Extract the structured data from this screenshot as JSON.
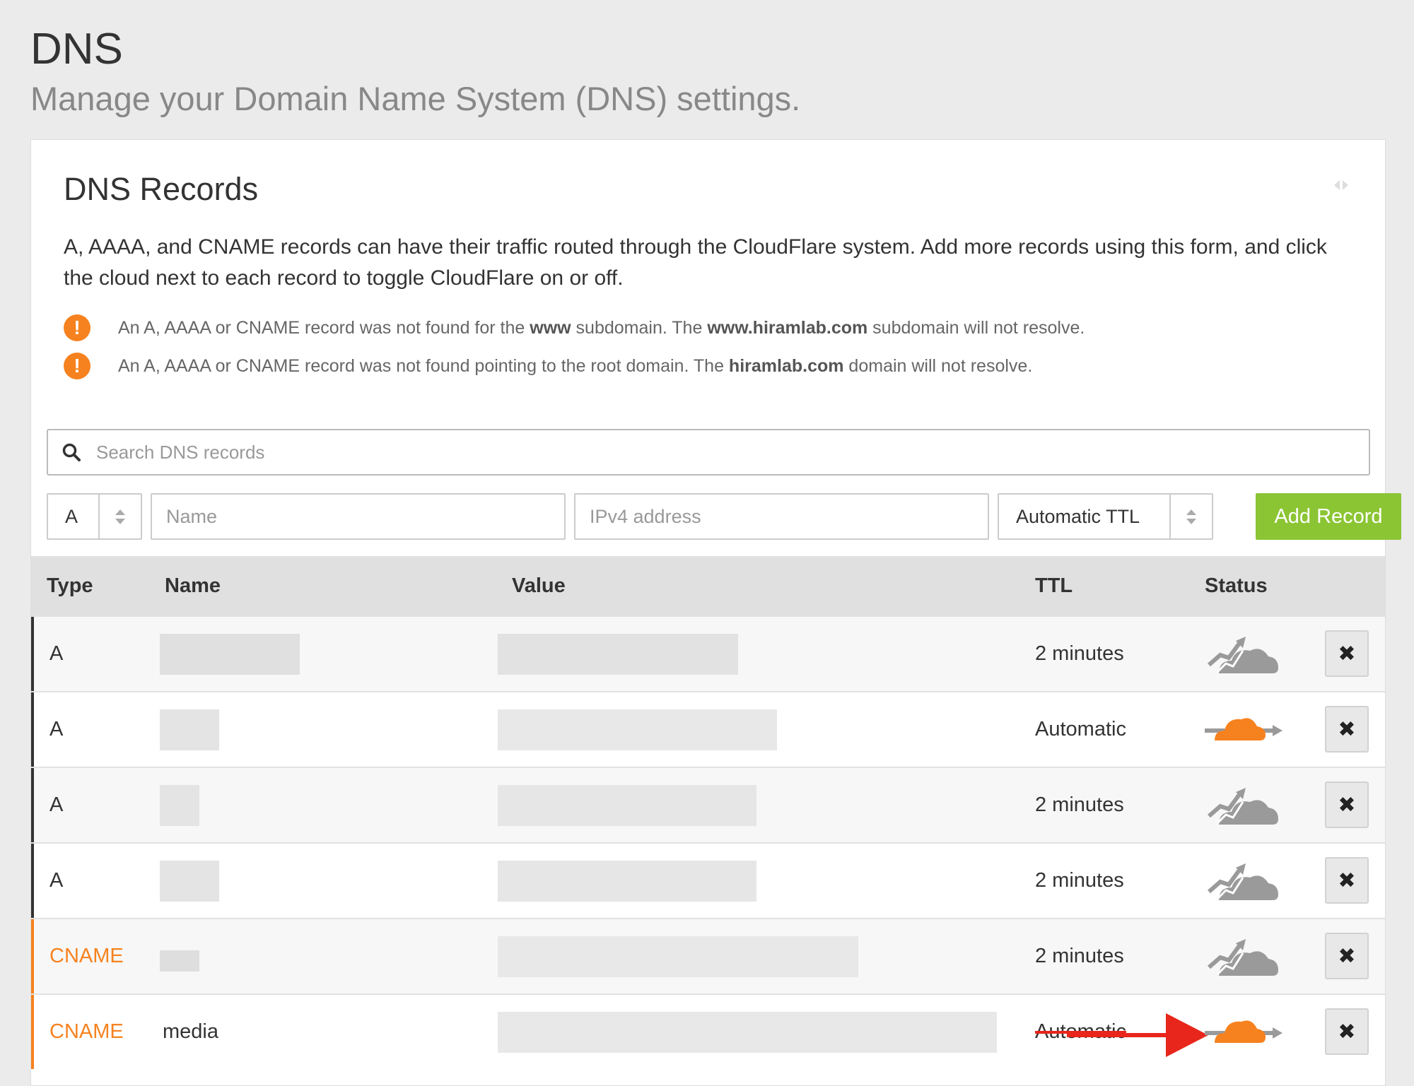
{
  "header": {
    "title": "DNS",
    "subtitle": "Manage your Domain Name System (DNS) settings."
  },
  "card": {
    "title": "DNS Records",
    "description": "A, AAAA, and CNAME records can have their traffic routed through the CloudFlare system. Add more records using this form, and click the cloud next to each record to toggle CloudFlare on or off.",
    "warnings": [
      {
        "icon": "exclamation-icon",
        "text_a": "An A, AAAA or CNAME record was not found for the ",
        "bold_a": "www",
        "text_b": " subdomain. The ",
        "bold_b": "www.hiramlab.com",
        "text_c": " subdomain will not resolve."
      },
      {
        "icon": "exclamation-icon",
        "text_a": "An A, AAAA or CNAME record was not found pointing to the root domain. The ",
        "bold_a": "hiramlab.com",
        "text_b": " domain will not resolve."
      }
    ]
  },
  "search": {
    "placeholder": "Search DNS records"
  },
  "form": {
    "type_value": "A",
    "name_placeholder": "Name",
    "value_placeholder": "IPv4 address",
    "ttl_value": "Automatic TTL",
    "add_label": "Add Record"
  },
  "table": {
    "headers": {
      "type": "Type",
      "name": "Name",
      "value": "Value",
      "ttl": "TTL",
      "status": "Status"
    },
    "delete_symbol": "✖",
    "rows": [
      {
        "type": "A",
        "name": "",
        "value": "",
        "ttl": "2 minutes",
        "status": "dns-only-cloud-icon"
      },
      {
        "type": "A",
        "name": "",
        "value": "",
        "ttl": "Automatic",
        "status": "proxied-cloud-icon"
      },
      {
        "type": "A",
        "name": "",
        "value": "",
        "ttl": "2 minutes",
        "status": "dns-only-cloud-icon"
      },
      {
        "type": "A",
        "name": "",
        "value": "",
        "ttl": "2 minutes",
        "status": "dns-only-cloud-icon"
      },
      {
        "type": "CNAME",
        "name": "",
        "value": "",
        "ttl": "2 minutes",
        "status": "dns-only-cloud-icon"
      },
      {
        "type": "CNAME",
        "name": "media",
        "value": "",
        "ttl": "Automatic",
        "status": "proxied-cloud-icon"
      }
    ]
  },
  "colors": {
    "brand_orange": "#f6821f",
    "add_green": "#8bc534",
    "cloud_grey": "#999999",
    "annotation_red": "#e8261c"
  }
}
